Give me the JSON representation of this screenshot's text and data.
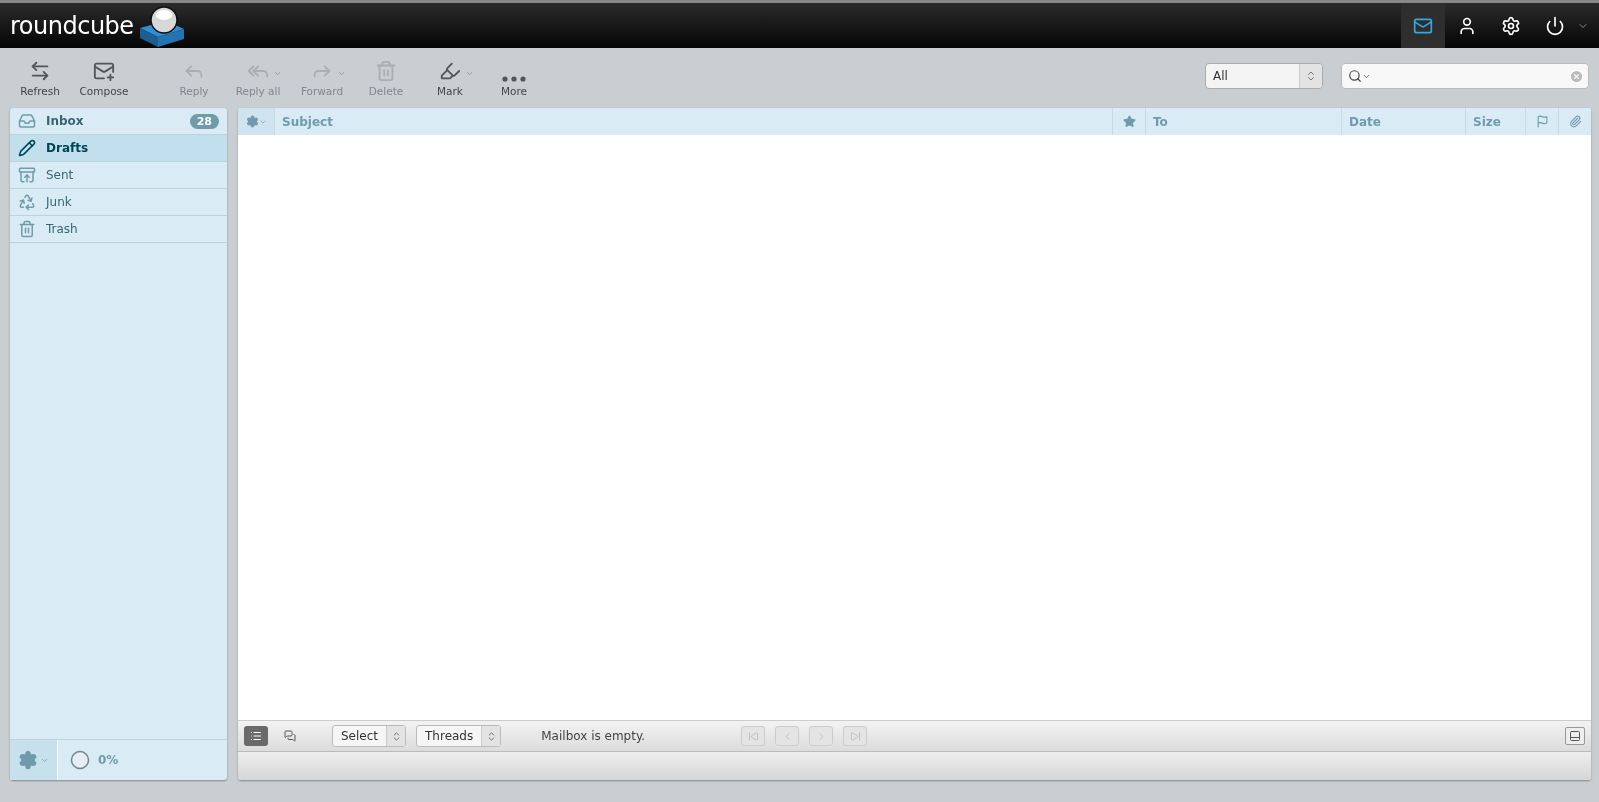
{
  "logo": {
    "text": "roundcube"
  },
  "top_nav": [
    {
      "kind": "mail",
      "selected": true
    },
    {
      "kind": "contacts",
      "selected": false
    },
    {
      "kind": "settings",
      "selected": false
    },
    {
      "kind": "logout",
      "selected": false
    }
  ],
  "toolbar": [
    {
      "kind": "refresh",
      "label": "Refresh",
      "disabled": false,
      "dropdown": false
    },
    {
      "kind": "compose",
      "label": "Compose",
      "disabled": false,
      "dropdown": false
    },
    {
      "kind": "reply",
      "label": "Reply",
      "disabled": true,
      "dropdown": false
    },
    {
      "kind": "reply-all",
      "label": "Reply all",
      "disabled": true,
      "dropdown": true
    },
    {
      "kind": "forward",
      "label": "Forward",
      "disabled": true,
      "dropdown": true
    },
    {
      "kind": "delete",
      "label": "Delete",
      "disabled": true,
      "dropdown": false
    },
    {
      "kind": "mark",
      "label": "Mark",
      "disabled": false,
      "dropdown": true
    },
    {
      "kind": "more",
      "label": "More",
      "disabled": false,
      "dropdown": false
    }
  ],
  "filter": {
    "value": "All"
  },
  "folders": [
    {
      "kind": "inbox",
      "name": "Inbox",
      "selected": false,
      "unread": "28"
    },
    {
      "kind": "drafts",
      "name": "Drafts",
      "selected": true
    },
    {
      "kind": "sent",
      "name": "Sent",
      "selected": false
    },
    {
      "kind": "junk",
      "name": "Junk",
      "selected": false
    },
    {
      "kind": "trash",
      "name": "Trash",
      "selected": false
    }
  ],
  "quota": {
    "label": "0%"
  },
  "columns": [
    {
      "kind": "options"
    },
    {
      "kind": "text",
      "label": "Subject"
    },
    {
      "kind": "star"
    },
    {
      "kind": "text",
      "label": "To"
    },
    {
      "kind": "text",
      "label": "Date"
    },
    {
      "kind": "text",
      "label": "Size"
    },
    {
      "kind": "flag"
    },
    {
      "kind": "attachment"
    }
  ],
  "list_footer": {
    "view_modes": [
      {
        "kind": "list",
        "selected": true
      },
      {
        "kind": "threads",
        "selected": false
      }
    ],
    "selects": [
      {
        "value": "Select"
      },
      {
        "value": "Threads"
      }
    ],
    "status": "Mailbox is empty.",
    "pager": [
      {
        "kind": "first",
        "disabled": true
      },
      {
        "kind": "previous",
        "disabled": true
      },
      {
        "kind": "next",
        "disabled": true
      },
      {
        "kind": "last",
        "disabled": true
      }
    ]
  }
}
